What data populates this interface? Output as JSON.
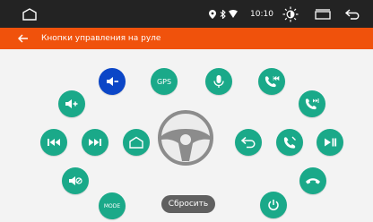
{
  "status": {
    "time": "10:10"
  },
  "header": {
    "title": "Кнопки управления на руле"
  },
  "buttons": {
    "gps_label": "GPS",
    "mode_label": "MODE"
  },
  "reset_label": "Сбросить",
  "colors": {
    "button": "#1aa989",
    "selected_button": "#0b46c7",
    "title_bar": "#f0520c",
    "status_bar": "#232323",
    "reset_button": "#606060"
  }
}
